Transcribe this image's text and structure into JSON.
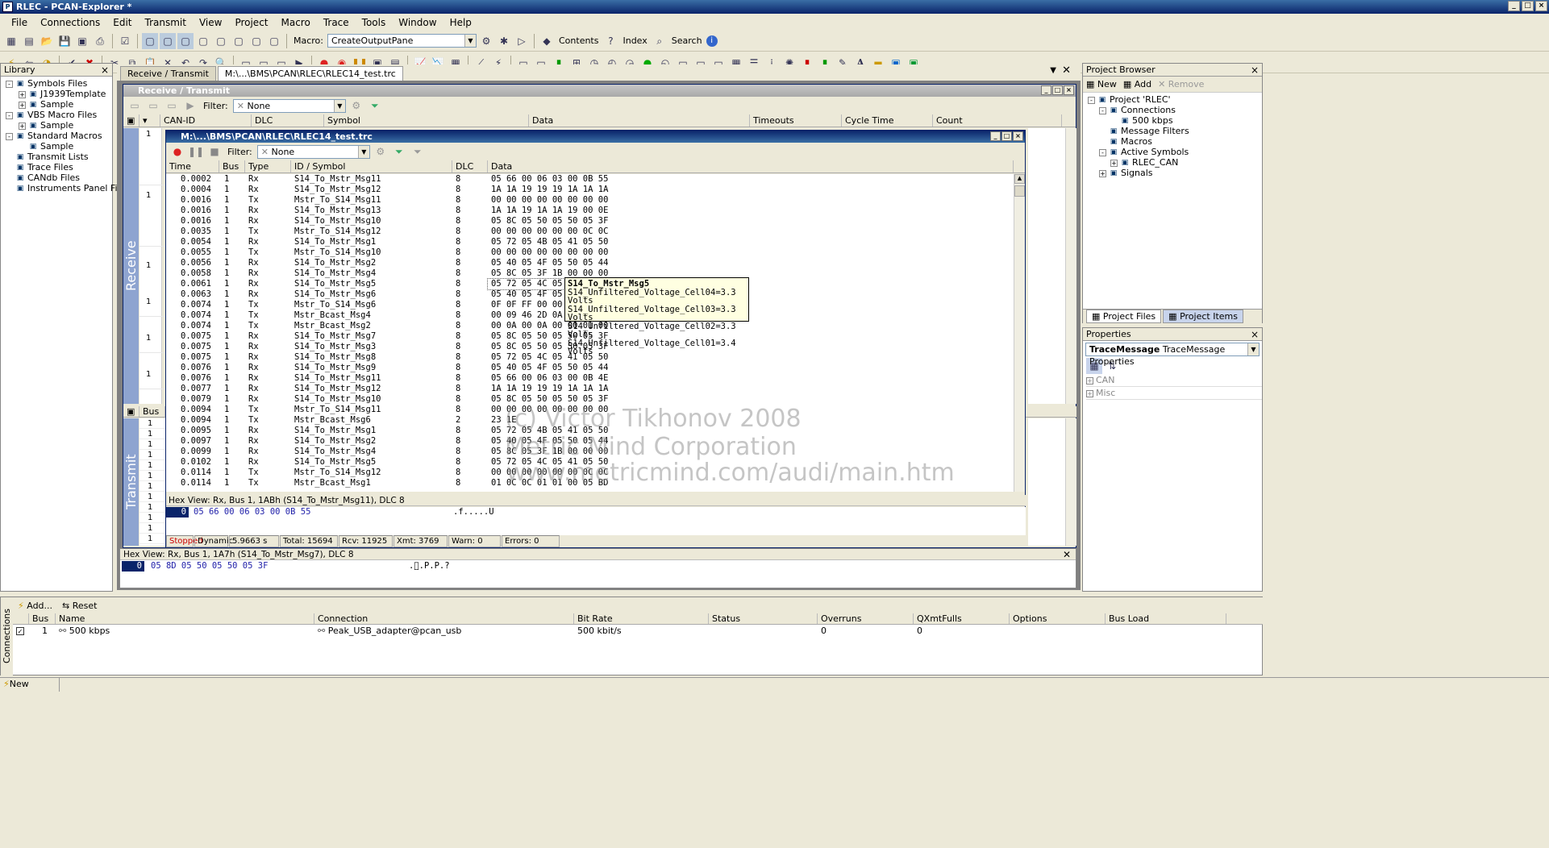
{
  "window": {
    "title": "RLEC - PCAN-Explorer *"
  },
  "menu": [
    "File",
    "Connections",
    "Edit",
    "Transmit",
    "View",
    "Project",
    "Macro",
    "Trace",
    "Tools",
    "Window",
    "Help"
  ],
  "toolbar1": {
    "macro_label": "Macro:",
    "macro_value": "CreateOutputPane",
    "contents": "Contents",
    "index": "Index",
    "search": "Search"
  },
  "library": {
    "title": "Library",
    "items": [
      {
        "label": "Symbols Files",
        "indent": 0,
        "exp": "-",
        "icon": "SYM"
      },
      {
        "label": "J1939Template",
        "indent": 1,
        "exp": "+",
        "icon": "SYM"
      },
      {
        "label": "Sample",
        "indent": 1,
        "exp": "+",
        "icon": "SYM"
      },
      {
        "label": "VBS Macro Files",
        "indent": 0,
        "exp": "-",
        "icon": "VB"
      },
      {
        "label": "Sample",
        "indent": 1,
        "exp": "+",
        "icon": "VB"
      },
      {
        "label": "Standard Macros",
        "indent": 0,
        "exp": "-",
        "icon": "M"
      },
      {
        "label": "Sample",
        "indent": 1,
        "exp": "",
        "icon": "M"
      },
      {
        "label": "Transmit Lists",
        "indent": 0,
        "exp": "",
        "icon": "TL"
      },
      {
        "label": "Trace Files",
        "indent": 0,
        "exp": "",
        "icon": "TF"
      },
      {
        "label": "CANdb Files",
        "indent": 0,
        "exp": "",
        "icon": "DB"
      },
      {
        "label": "Instruments Panel Files",
        "indent": 0,
        "exp": "",
        "icon": "IP"
      }
    ]
  },
  "tabs": [
    "Receive / Transmit",
    "M:\\...\\BMS\\PCAN\\RLEC\\RLEC14_test.trc"
  ],
  "rx": {
    "title": "Receive / Transmit",
    "filter_label": "Filter:",
    "filter_value": "None",
    "columns": [
      "CAN-ID",
      "DLC",
      "Symbol",
      "Data",
      "Timeouts",
      "Cycle Time",
      "Count"
    ],
    "receive_label": "Receive",
    "transmit_label": "Transmit",
    "rx_counts": [
      "1",
      "1",
      "1",
      "1",
      "1",
      "1"
    ],
    "tx_header": "Bus",
    "tx_rows": [
      "1",
      "1",
      "1",
      "1",
      "1",
      "1",
      "1",
      "1",
      "1",
      "1",
      "1",
      "1"
    ]
  },
  "trace": {
    "title": "M:\\...\\BMS\\PCAN\\RLEC\\RLEC14_test.trc",
    "filter_label": "Filter:",
    "filter_value": "None",
    "columns": [
      "Time",
      "Bus",
      "Type",
      "ID / Symbol",
      "DLC",
      "Data"
    ],
    "rows": [
      [
        "0.0002",
        "1",
        "Rx",
        "S14_To_Mstr_Msg11",
        "8",
        "05 66 00 06 03 00 0B 55"
      ],
      [
        "0.0004",
        "1",
        "Rx",
        "S14_To_Mstr_Msg12",
        "8",
        "1A 1A 19 19 19 1A 1A 1A"
      ],
      [
        "0.0016",
        "1",
        "Tx",
        "Mstr_To_S14_Msg11",
        "8",
        "00 00 00 00 00 00 00 00"
      ],
      [
        "0.0016",
        "1",
        "Rx",
        "S14_To_Mstr_Msg13",
        "8",
        "1A 1A 19 1A 1A 19 00 0E"
      ],
      [
        "0.0016",
        "1",
        "Rx",
        "S14_To_Mstr_Msg10",
        "8",
        "05 8C 05 50 05 50 05 3F"
      ],
      [
        "0.0035",
        "1",
        "Tx",
        "Mstr_To_S14_Msg12",
        "8",
        "00 00 00 00 00 00 0C 0C"
      ],
      [
        "0.0054",
        "1",
        "Rx",
        "S14_To_Mstr_Msg1",
        "8",
        "05 72 05 4B 05 41 05 50"
      ],
      [
        "0.0055",
        "1",
        "Tx",
        "Mstr_To_S14_Msg10",
        "8",
        "00 00 00 00 00 00 00 00"
      ],
      [
        "0.0056",
        "1",
        "Rx",
        "S14_To_Mstr_Msg2",
        "8",
        "05 40 05 4F 05 50 05 44"
      ],
      [
        "0.0058",
        "1",
        "Rx",
        "S14_To_Mstr_Msg4",
        "8",
        "05 8C 05 3F 1B 00 00 00"
      ],
      [
        "0.0061",
        "1",
        "Rx",
        "S14_To_Mstr_Msg5",
        "8",
        "05 72 05 4C 05 41 05 50"
      ],
      [
        "0.0063",
        "1",
        "Rx",
        "S14_To_Mstr_Msg6",
        "8",
        "05 40 05 4F 05 50 05 44"
      ],
      [
        "0.0074",
        "1",
        "Tx",
        "Mstr_To_S14_Msg6",
        "8",
        "0F 0F FF 00 00 00 00 00"
      ],
      [
        "0.0074",
        "1",
        "Tx",
        "Mstr_Bcast_Msg4",
        "8",
        "00 09 46 2D 0A 02 00 40"
      ],
      [
        "0.0074",
        "1",
        "Tx",
        "Mstr_Bcast_Msg2",
        "8",
        "00 0A 00 0A 00 00 01 00"
      ],
      [
        "0.0075",
        "1",
        "Rx",
        "S14_To_Mstr_Msg7",
        "8",
        "05 8C 05 50 05 50 05 3F"
      ],
      [
        "0.0075",
        "1",
        "Rx",
        "S14_To_Mstr_Msg3",
        "8",
        "05 8C 05 50 05 50 05 3F"
      ],
      [
        "0.0075",
        "1",
        "Rx",
        "S14_To_Mstr_Msg8",
        "8",
        "05 72 05 4C 05 41 05 50"
      ],
      [
        "0.0076",
        "1",
        "Rx",
        "S14_To_Mstr_Msg9",
        "8",
        "05 40 05 4F 05 50 05 44"
      ],
      [
        "0.0076",
        "1",
        "Rx",
        "S14_To_Mstr_Msg11",
        "8",
        "05 66 00 06 03 00 0B 4E"
      ],
      [
        "0.0077",
        "1",
        "Rx",
        "S14_To_Mstr_Msg12",
        "8",
        "1A 1A 19 19 19 1A 1A 1A"
      ],
      [
        "0.0079",
        "1",
        "Rx",
        "S14_To_Mstr_Msg10",
        "8",
        "05 8C 05 50 05 50 05 3F"
      ],
      [
        "0.0094",
        "1",
        "Tx",
        "Mstr_To_S14_Msg11",
        "8",
        "00 00 00 00 00 00 00 00"
      ],
      [
        "0.0094",
        "1",
        "Tx",
        "Mstr_Bcast_Msg6",
        "2",
        "23 1E"
      ],
      [
        "0.0095",
        "1",
        "Rx",
        "S14_To_Mstr_Msg1",
        "8",
        "05 72 05 4B 05 41 05 50"
      ],
      [
        "0.0097",
        "1",
        "Rx",
        "S14_To_Mstr_Msg2",
        "8",
        "05 40 05 4F 05 50 05 44"
      ],
      [
        "0.0099",
        "1",
        "Rx",
        "S14_To_Mstr_Msg4",
        "8",
        "05 8C 05 3F 1B 00 00 00"
      ],
      [
        "0.0102",
        "1",
        "Rx",
        "S14_To_Mstr_Msg5",
        "8",
        "05 72 05 4C 05 41 05 50"
      ],
      [
        "0.0114",
        "1",
        "Tx",
        "Mstr_To_S14_Msg12",
        "8",
        "00 00 00 00 00 00 0C 0C"
      ],
      [
        "0.0114",
        "1",
        "Tx",
        "Mstr_Bcast_Msg1",
        "8",
        "01 0C 0C 01 01 00 05 BD"
      ]
    ],
    "tooltip": {
      "title": "S14_To_Mstr_Msg5",
      "lines": [
        "S14_Unfiltered_Voltage_Cell04=3.3 Volts",
        "S14_Unfiltered_Voltage_Cell03=3.3 Volts",
        "S14_Unfiltered_Voltage_Cell02=3.3 Volts",
        "S14_Unfiltered_Voltage_Cell01=3.4 Volts"
      ]
    },
    "hexview": {
      "header": "Hex View:  Rx, Bus 1, 1ABh (S14_To_Mstr_Msg11), DLC 8",
      "offset": "0",
      "bytes": "05 66 00 06 03 00 0B 55",
      "ascii": ".f.....U"
    },
    "status": {
      "state": "Stopped",
      "mode": "Dynamic",
      "time": "5.9663 s",
      "total": "Total: 15694",
      "rcv": "Rcv: 11925",
      "xmt": "Xmt: 3769",
      "warn": "Warn: 0",
      "errors": "Errors: 0"
    }
  },
  "hexview2": {
    "header": "Hex View:  Rx, Bus 1, 1A7h (S14_To_Mstr_Msg7), DLC 8",
    "offset": "0",
    "bytes": "05 8D 05 50 05 50 05 3F",
    "ascii": ".\u0000.P.P.?"
  },
  "watermark": [
    "(c) Victor Tikhonov 2008",
    "Metric Mind Corporation",
    "www.metricmind.com/audi/main.htm"
  ],
  "project": {
    "title": "Project Browser",
    "new": "New",
    "add": "Add",
    "remove": "Remove",
    "items": [
      {
        "label": "Project 'RLEC'",
        "indent": 0,
        "exp": "-"
      },
      {
        "label": "Connections",
        "indent": 1,
        "exp": "-"
      },
      {
        "label": "500 kbps",
        "indent": 2,
        "exp": ""
      },
      {
        "label": "Message Filters",
        "indent": 1,
        "exp": ""
      },
      {
        "label": "Macros",
        "indent": 1,
        "exp": ""
      },
      {
        "label": "Active Symbols",
        "indent": 1,
        "exp": "-"
      },
      {
        "label": "RLEC_CAN",
        "indent": 2,
        "exp": "+"
      },
      {
        "label": "Signals",
        "indent": 1,
        "exp": "+"
      }
    ],
    "tab_files": "Project Files",
    "tab_items": "Project Items"
  },
  "properties": {
    "title": "Properties",
    "object_bold": "TraceMessage",
    "object_rest": "TraceMessage Properties",
    "groups": [
      "CAN",
      "Misc"
    ]
  },
  "connections": {
    "add": "Add...",
    "reset": "Reset",
    "columns": [
      "Bus",
      "Name",
      "Connection",
      "Bit Rate",
      "Status",
      "Overruns",
      "QXmtFulls",
      "Options",
      "Bus Load"
    ],
    "row": {
      "bus": "1",
      "name": "500 kbps",
      "connection": "Peak_USB_adapter@pcan_usb",
      "bitrate": "500 kbit/s",
      "status": "",
      "overruns": "0",
      "qxmt": "0",
      "options": "",
      "busload": ""
    },
    "sidelabel": "Connections"
  },
  "statusbar": {
    "new_events": "New Events"
  }
}
